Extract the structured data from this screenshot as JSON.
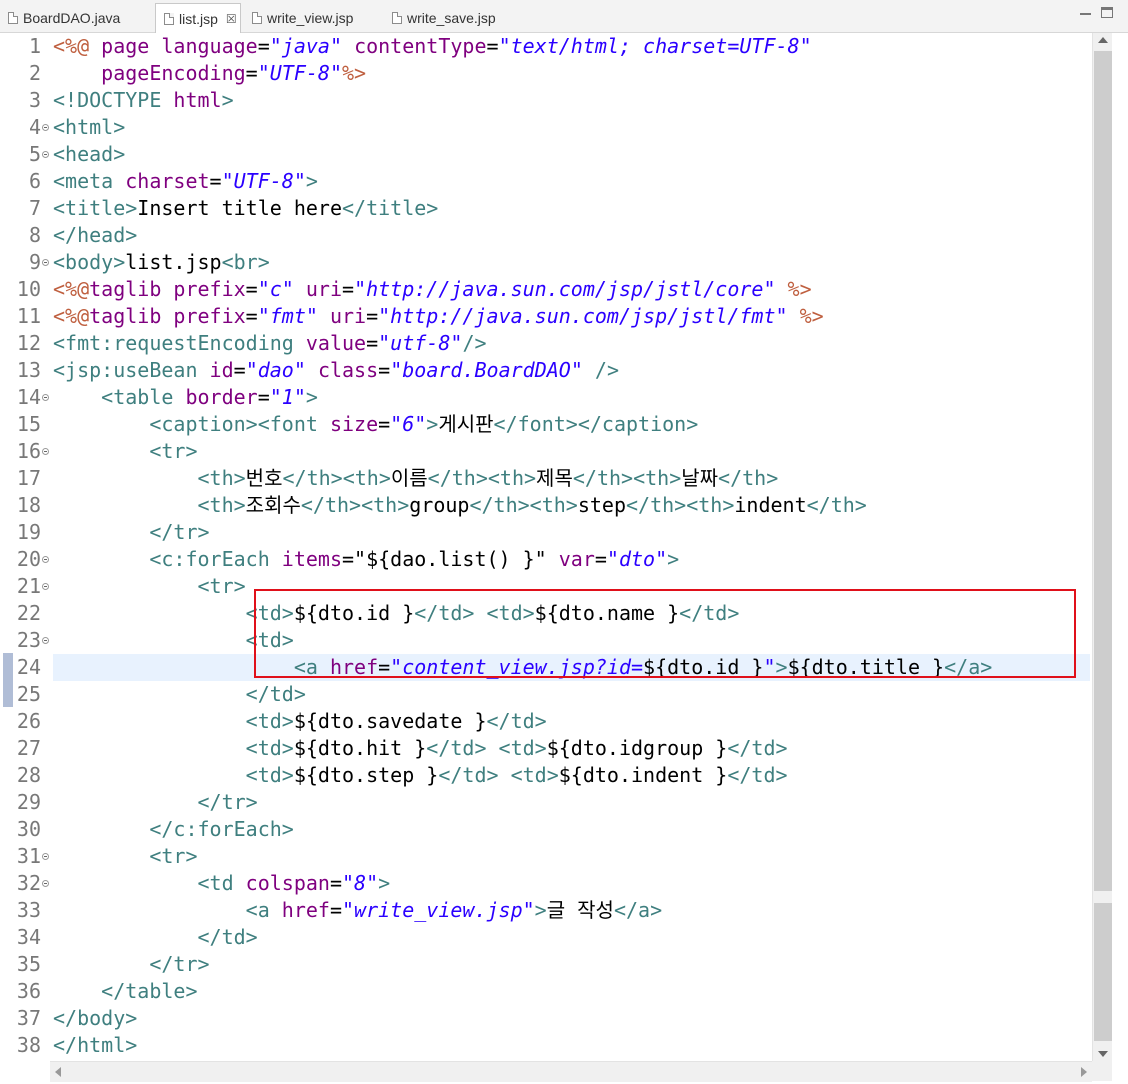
{
  "tabs": [
    {
      "label": "BoardDAO.java",
      "active": false
    },
    {
      "label": "list.jsp",
      "active": true,
      "close": "☒"
    },
    {
      "label": "write_view.jsp",
      "active": false
    },
    {
      "label": "write_save.jsp",
      "active": false
    }
  ],
  "window": {
    "minimize_icon": "minimize-icon",
    "maximize_icon": "maximize-icon"
  },
  "editor": {
    "current_line": 24,
    "highlighted_lines": [
      23,
      24,
      25
    ],
    "lines": [
      {
        "n": "1",
        "fold": false,
        "tokens": [
          [
            "dir",
            "<%@ "
          ],
          [
            "attr",
            "page "
          ],
          [
            "attr",
            "language"
          ],
          [
            "el",
            "="
          ],
          [
            "val",
            "\"java\" "
          ],
          [
            "attr",
            "contentType"
          ],
          [
            "el",
            "="
          ],
          [
            "val",
            "\"text/html; charset=UTF-8\""
          ]
        ]
      },
      {
        "n": "2",
        "fold": false,
        "tokens": [
          [
            "el",
            "    "
          ],
          [
            "attr",
            "pageEncoding"
          ],
          [
            "el",
            "="
          ],
          [
            "val",
            "\"UTF-8\""
          ],
          [
            "dir",
            "%>"
          ]
        ]
      },
      {
        "n": "3",
        "fold": false,
        "tokens": [
          [
            "tag",
            "<!DOCTYPE "
          ],
          [
            "attr",
            "html"
          ],
          [
            "tag",
            ">"
          ]
        ]
      },
      {
        "n": "4",
        "fold": true,
        "tokens": [
          [
            "tag",
            "<html>"
          ]
        ]
      },
      {
        "n": "5",
        "fold": true,
        "tokens": [
          [
            "tag",
            "<head>"
          ]
        ]
      },
      {
        "n": "6",
        "fold": false,
        "tokens": [
          [
            "tag",
            "<meta "
          ],
          [
            "attr",
            "charset"
          ],
          [
            "el",
            "="
          ],
          [
            "val",
            "\"UTF-8\""
          ],
          [
            "tag",
            ">"
          ]
        ]
      },
      {
        "n": "7",
        "fold": false,
        "tokens": [
          [
            "tag",
            "<title>"
          ],
          [
            "txt",
            "Insert title here"
          ],
          [
            "tag",
            "</title>"
          ]
        ]
      },
      {
        "n": "8",
        "fold": false,
        "tokens": [
          [
            "tag",
            "</head>"
          ]
        ]
      },
      {
        "n": "9",
        "fold": true,
        "tokens": [
          [
            "tag",
            "<body>"
          ],
          [
            "txt",
            "list.jsp"
          ],
          [
            "tag",
            "<br>"
          ]
        ]
      },
      {
        "n": "10",
        "fold": false,
        "tokens": [
          [
            "dir",
            "<%@"
          ],
          [
            "attr",
            "taglib "
          ],
          [
            "attr",
            "prefix"
          ],
          [
            "el",
            "="
          ],
          [
            "val",
            "\"c\" "
          ],
          [
            "attr",
            "uri"
          ],
          [
            "el",
            "="
          ],
          [
            "val",
            "\"http://java.sun.com/jsp/jstl/core\" "
          ],
          [
            "dir",
            "%>"
          ]
        ]
      },
      {
        "n": "11",
        "fold": false,
        "tokens": [
          [
            "dir",
            "<%@"
          ],
          [
            "attr",
            "taglib "
          ],
          [
            "attr",
            "prefix"
          ],
          [
            "el",
            "="
          ],
          [
            "val",
            "\"fmt\" "
          ],
          [
            "attr",
            "uri"
          ],
          [
            "el",
            "="
          ],
          [
            "val",
            "\"http://java.sun.com/jsp/jstl/fmt\" "
          ],
          [
            "dir",
            "%>"
          ]
        ]
      },
      {
        "n": "12",
        "fold": false,
        "tokens": [
          [
            "tag",
            "<fmt:requestEncoding "
          ],
          [
            "attr",
            "value"
          ],
          [
            "el",
            "="
          ],
          [
            "val",
            "\"utf-8\""
          ],
          [
            "tag",
            "/>"
          ]
        ]
      },
      {
        "n": "13",
        "fold": false,
        "tokens": [
          [
            "tag",
            "<jsp:useBean "
          ],
          [
            "attr",
            "id"
          ],
          [
            "el",
            "="
          ],
          [
            "val",
            "\"dao\" "
          ],
          [
            "attr",
            "class"
          ],
          [
            "el",
            "="
          ],
          [
            "val",
            "\"board.BoardDAO\" "
          ],
          [
            "tag",
            "/>"
          ]
        ]
      },
      {
        "n": "14",
        "fold": true,
        "tokens": [
          [
            "el",
            "    "
          ],
          [
            "tag",
            "<table "
          ],
          [
            "attr",
            "border"
          ],
          [
            "el",
            "="
          ],
          [
            "val",
            "\"1\""
          ],
          [
            "tag",
            ">"
          ]
        ]
      },
      {
        "n": "15",
        "fold": false,
        "tokens": [
          [
            "el",
            "        "
          ],
          [
            "tag",
            "<caption><font "
          ],
          [
            "attr",
            "size"
          ],
          [
            "el",
            "="
          ],
          [
            "val",
            "\"6\""
          ],
          [
            "tag",
            ">"
          ],
          [
            "txt",
            "게시판"
          ],
          [
            "tag",
            "</font></caption>"
          ]
        ]
      },
      {
        "n": "16",
        "fold": true,
        "tokens": [
          [
            "el",
            "        "
          ],
          [
            "tag",
            "<tr>"
          ]
        ]
      },
      {
        "n": "17",
        "fold": false,
        "tokens": [
          [
            "el",
            "            "
          ],
          [
            "tag",
            "<th>"
          ],
          [
            "txt",
            "번호"
          ],
          [
            "tag",
            "</th><th>"
          ],
          [
            "txt",
            "이름"
          ],
          [
            "tag",
            "</th><th>"
          ],
          [
            "txt",
            "제목"
          ],
          [
            "tag",
            "</th><th>"
          ],
          [
            "txt",
            "날짜"
          ],
          [
            "tag",
            "</th>"
          ]
        ]
      },
      {
        "n": "18",
        "fold": false,
        "tokens": [
          [
            "el",
            "            "
          ],
          [
            "tag",
            "<th>"
          ],
          [
            "txt",
            "조회수"
          ],
          [
            "tag",
            "</th><th>"
          ],
          [
            "txt",
            "group"
          ],
          [
            "tag",
            "</th><th>"
          ],
          [
            "txt",
            "step"
          ],
          [
            "tag",
            "</th><th>"
          ],
          [
            "txt",
            "indent"
          ],
          [
            "tag",
            "</th>"
          ]
        ]
      },
      {
        "n": "19",
        "fold": false,
        "tokens": [
          [
            "el",
            "        "
          ],
          [
            "tag",
            "</tr>"
          ]
        ]
      },
      {
        "n": "20",
        "fold": true,
        "tokens": [
          [
            "el",
            "        "
          ],
          [
            "tag",
            "<c:forEach "
          ],
          [
            "attr",
            "items"
          ],
          [
            "el",
            "=\"${dao.list() }\" "
          ],
          [
            "attr",
            "var"
          ],
          [
            "el",
            "="
          ],
          [
            "val",
            "\"dto\""
          ],
          [
            "tag",
            ">"
          ]
        ]
      },
      {
        "n": "21",
        "fold": true,
        "tokens": [
          [
            "el",
            "            "
          ],
          [
            "tag",
            "<tr>"
          ]
        ]
      },
      {
        "n": "22",
        "fold": false,
        "tokens": [
          [
            "el",
            "                "
          ],
          [
            "tag",
            "<td>"
          ],
          [
            "txt",
            "${dto.id }"
          ],
          [
            "tag",
            "</td> <td>"
          ],
          [
            "txt",
            "${dto.name }"
          ],
          [
            "tag",
            "</td>"
          ]
        ]
      },
      {
        "n": "23",
        "fold": true,
        "tokens": [
          [
            "el",
            "                "
          ],
          [
            "tag",
            "<td>"
          ]
        ]
      },
      {
        "n": "24",
        "fold": false,
        "tokens": [
          [
            "el",
            "                    "
          ],
          [
            "tag",
            "<a "
          ],
          [
            "attr",
            "href"
          ],
          [
            "el",
            "="
          ],
          [
            "val",
            "\"content_view.jsp?id="
          ],
          [
            "txt",
            "${dto.id }"
          ],
          [
            "val",
            "\""
          ],
          [
            "tag",
            ">"
          ],
          [
            "txt",
            "${dto.title }"
          ],
          [
            "tag",
            "</a>"
          ]
        ]
      },
      {
        "n": "25",
        "fold": false,
        "tokens": [
          [
            "el",
            "                "
          ],
          [
            "tag",
            "</td>"
          ]
        ]
      },
      {
        "n": "26",
        "fold": false,
        "tokens": [
          [
            "el",
            "                "
          ],
          [
            "tag",
            "<td>"
          ],
          [
            "txt",
            "${dto.savedate }"
          ],
          [
            "tag",
            "</td>"
          ]
        ]
      },
      {
        "n": "27",
        "fold": false,
        "tokens": [
          [
            "el",
            "                "
          ],
          [
            "tag",
            "<td>"
          ],
          [
            "txt",
            "${dto.hit }"
          ],
          [
            "tag",
            "</td> <td>"
          ],
          [
            "txt",
            "${dto.idgroup }"
          ],
          [
            "tag",
            "</td>"
          ]
        ]
      },
      {
        "n": "28",
        "fold": false,
        "tokens": [
          [
            "el",
            "                "
          ],
          [
            "tag",
            "<td>"
          ],
          [
            "txt",
            "${dto.step }"
          ],
          [
            "tag",
            "</td> <td>"
          ],
          [
            "txt",
            "${dto.indent }"
          ],
          [
            "tag",
            "</td>"
          ]
        ]
      },
      {
        "n": "29",
        "fold": false,
        "tokens": [
          [
            "el",
            "            "
          ],
          [
            "tag",
            "</tr>"
          ]
        ]
      },
      {
        "n": "30",
        "fold": false,
        "tokens": [
          [
            "el",
            "        "
          ],
          [
            "tag",
            "</c:forEach>"
          ]
        ]
      },
      {
        "n": "31",
        "fold": true,
        "tokens": [
          [
            "el",
            "        "
          ],
          [
            "tag",
            "<tr>"
          ]
        ]
      },
      {
        "n": "32",
        "fold": true,
        "tokens": [
          [
            "el",
            "            "
          ],
          [
            "tag",
            "<td "
          ],
          [
            "attr",
            "colspan"
          ],
          [
            "el",
            "="
          ],
          [
            "val",
            "\"8\""
          ],
          [
            "tag",
            ">"
          ]
        ]
      },
      {
        "n": "33",
        "fold": false,
        "tokens": [
          [
            "el",
            "                "
          ],
          [
            "tag",
            "<a "
          ],
          [
            "attr",
            "href"
          ],
          [
            "el",
            "="
          ],
          [
            "val",
            "\"write_view.jsp\""
          ],
          [
            "tag",
            ">"
          ],
          [
            "txt",
            "글 작성"
          ],
          [
            "tag",
            "</a>"
          ]
        ]
      },
      {
        "n": "34",
        "fold": false,
        "tokens": [
          [
            "el",
            "            "
          ],
          [
            "tag",
            "</td>"
          ]
        ]
      },
      {
        "n": "35",
        "fold": false,
        "tokens": [
          [
            "el",
            "        "
          ],
          [
            "tag",
            "</tr>"
          ]
        ]
      },
      {
        "n": "36",
        "fold": false,
        "tokens": [
          [
            "el",
            "    "
          ],
          [
            "tag",
            "</table>"
          ]
        ]
      },
      {
        "n": "37",
        "fold": false,
        "tokens": [
          [
            "tag",
            "</body>"
          ]
        ]
      },
      {
        "n": "38",
        "fold": false,
        "tokens": [
          [
            "tag",
            "</html>"
          ]
        ]
      }
    ]
  },
  "colors": {
    "directive": "#bf5f3f",
    "tag": "#3f7f7f",
    "attribute": "#7f007f",
    "value": "#2a00ff",
    "highlight_box": "#e0101a",
    "current_line": "#e8f2fe"
  }
}
